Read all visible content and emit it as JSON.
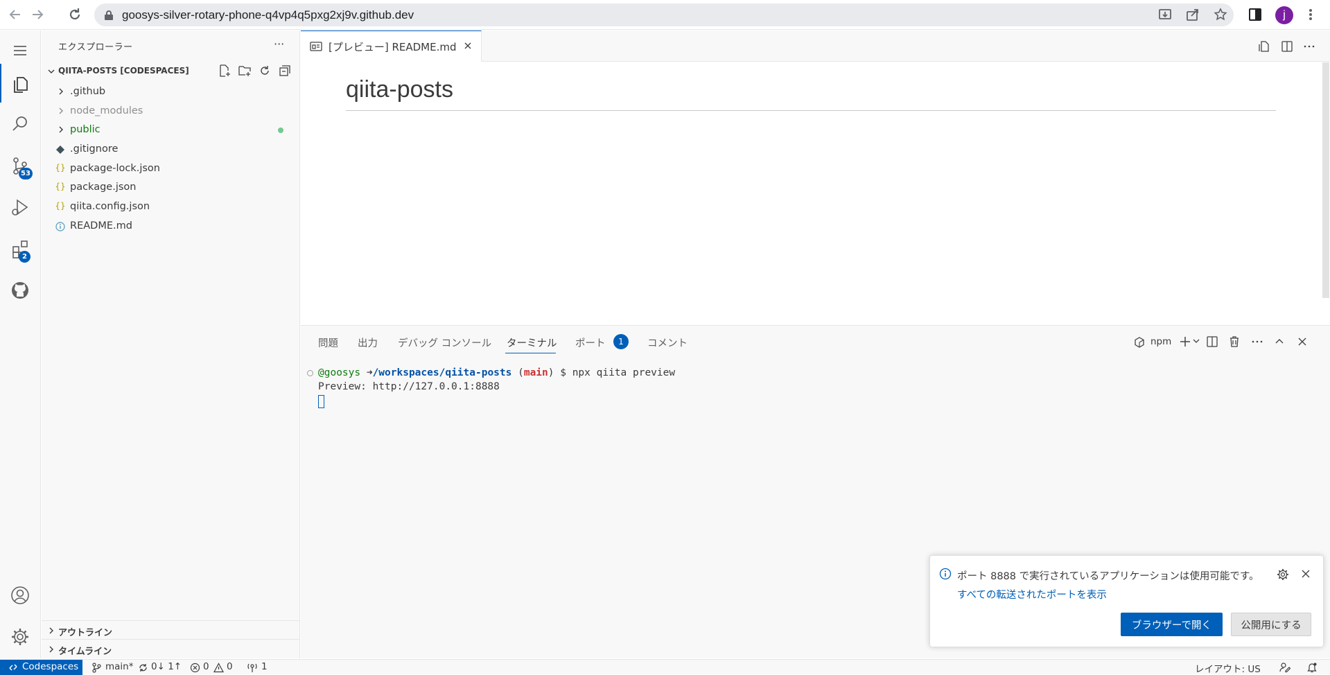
{
  "browser": {
    "url": "goosys-silver-rotary-phone-q4vp4q5pxg2xj9v.github.dev",
    "profile_initial": "j"
  },
  "activity_bar": {
    "scm_badge": "53",
    "extensions_badge": "2"
  },
  "sidebar": {
    "title": "エクスプローラー",
    "more": "···",
    "section_title": "QIITA-POSTS [CODESPACES]",
    "items": [
      {
        "name": ".github",
        "type": "folder"
      },
      {
        "name": "node_modules",
        "type": "folder"
      },
      {
        "name": "public",
        "type": "folder"
      },
      {
        "name": ".gitignore",
        "type": "file"
      },
      {
        "name": "package-lock.json",
        "type": "json"
      },
      {
        "name": "package.json",
        "type": "json"
      },
      {
        "name": "qiita.config.json",
        "type": "json"
      },
      {
        "name": "README.md",
        "type": "info"
      }
    ],
    "outline": "アウトライン",
    "timeline": "タイムライン"
  },
  "editor": {
    "tab_label": "[プレビュー] README.md",
    "heading": "qiita-posts"
  },
  "panel": {
    "tabs": [
      "問題",
      "出力",
      "デバッグ コンソール",
      "ターミナル",
      "ポート",
      "コメント"
    ],
    "active_tab": "ターミナル",
    "ports_badge": "1",
    "terminal_name": "npm",
    "terminal": {
      "user": "@goosys",
      "arrow": "➜",
      "path": "/workspaces/qiita-posts",
      "branch_open": "(",
      "branch": "main",
      "branch_close": ")",
      "command": "$ npx qiita preview",
      "output": "Preview: http://127.0.0.1:8888"
    }
  },
  "notification": {
    "message": "ポート 8888 で実行されているアプリケーションは使用可能です。",
    "link": "すべての転送されたポートを表示",
    "primary_button": "ブラウザーで開く",
    "secondary_button": "公開用にする"
  },
  "statusbar": {
    "remote": "Codespaces",
    "branch": "main*",
    "sync": "0↓ 1↑",
    "errors": "0",
    "warnings": "0",
    "ports": "1",
    "layout": "レイアウト: US"
  },
  "colors": {
    "accent": "#005fb8",
    "folder_modified": "#0f7b0f",
    "ignored": "#8e8e8e",
    "json_icon": "#b8a000"
  }
}
